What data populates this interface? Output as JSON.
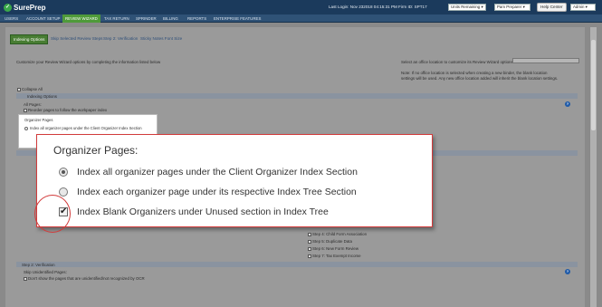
{
  "header": {
    "logo_text": "SurePrep",
    "last_login": "Last Login: Nov 232018 04:15:31 PM",
    "firm_id": "Firm ID: SPT17",
    "units_select": "Units Remaining",
    "user_select": "Pam Preparer",
    "help_button": "Help Center",
    "admin_select": "Admin"
  },
  "nav": {
    "items": [
      "USERS",
      "ACCOUNT SETUP",
      "REVIEW WIZARD",
      "TAX RETURN",
      "SPRINDER",
      "BILLING",
      "REPORTS",
      "ENTERPRISE FEATURES"
    ],
    "active_index": 2
  },
  "subtabs": [
    "Indexing Options",
    "Skip Selected Review Steps",
    "Step 2: Verification",
    "Sticky Notes Font Size"
  ],
  "page": {
    "intro": "Customize your Review Wizard options by completing the information listed below",
    "office_label": "Select an office location to customize its Review Wizard options:",
    "note_line1": "Note: If no office location is selected when creating a new binder, the blank location",
    "note_line2": "settings will be used. Any new office location added will inherit the blank location settings.",
    "collapse_all": "Collapse All",
    "section_indexing": "Indexing Options",
    "all_pages": "All Pages:",
    "reorder_pages": "Reorder pages to follow the workpaper index",
    "mini_organizer_title": "Organizer Pages",
    "mini_option1": "Index all organizer pages under the Client Organizer Index Section",
    "steps": [
      "Step 4: Child Form Association",
      "Step 5: Duplicate Data",
      "Step 6: New Form Review",
      "Step 7: Tax Exempt Income"
    ],
    "section_verification": "Step 2: Verification",
    "skip_unidentified": "Skip Unidentified Pages:",
    "dont_show": "Don't show the pages that are unidentified/not recognized by OCR"
  },
  "callout": {
    "title": "Organizer Pages:",
    "options": [
      {
        "label": "Index all organizer pages under the Client Organizer Index Section",
        "type": "radio",
        "checked": true
      },
      {
        "label": "Index each organizer page under its respective Index Tree Section",
        "type": "radio",
        "checked": false
      },
      {
        "label": "Index Blank Organizers under Unused section in Index Tree",
        "type": "checkbox",
        "checked": true
      }
    ]
  },
  "colors": {
    "topbar": "#1b3a5c",
    "navbar": "#2f5276",
    "active_tab": "#4f9a3a",
    "highlight_red": "#d23b3b"
  }
}
